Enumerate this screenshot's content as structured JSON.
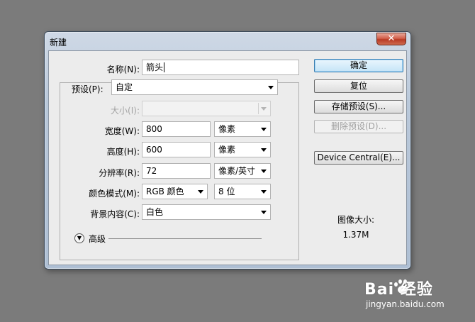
{
  "window": {
    "title": "新建",
    "close_glyph": "✕"
  },
  "form": {
    "name": {
      "label": "名称(N):",
      "value": "箭头"
    },
    "preset": {
      "label": "预设(P):",
      "value": "自定"
    },
    "size": {
      "label": "大小(I):",
      "value": ""
    },
    "width": {
      "label": "宽度(W):",
      "value": "800",
      "unit": "像素"
    },
    "height": {
      "label": "高度(H):",
      "value": "600",
      "unit": "像素"
    },
    "resolution": {
      "label": "分辨率(R):",
      "value": "72",
      "unit": "像素/英寸"
    },
    "color_mode": {
      "label": "颜色模式(M):",
      "mode": "RGB 颜色",
      "depth": "8 位"
    },
    "background": {
      "label": "背景内容(C):",
      "value": "白色"
    },
    "advanced": {
      "label": "高级",
      "icon": "expand-circle-icon"
    }
  },
  "buttons": {
    "ok": "确定",
    "reset": "复位",
    "save_preset": "存储预设(S)...",
    "delete_preset": "删除预设(D)...",
    "device_central": "Device Central(E)..."
  },
  "image_size": {
    "title": "图像大小:",
    "value": "1.37M"
  },
  "watermark": {
    "brand": "Bai 经验",
    "url": "jingyan.baidu.com"
  },
  "colors": {
    "accent": "#3c7fb1",
    "close": "#c9523c",
    "background": "#7b7b7b"
  }
}
